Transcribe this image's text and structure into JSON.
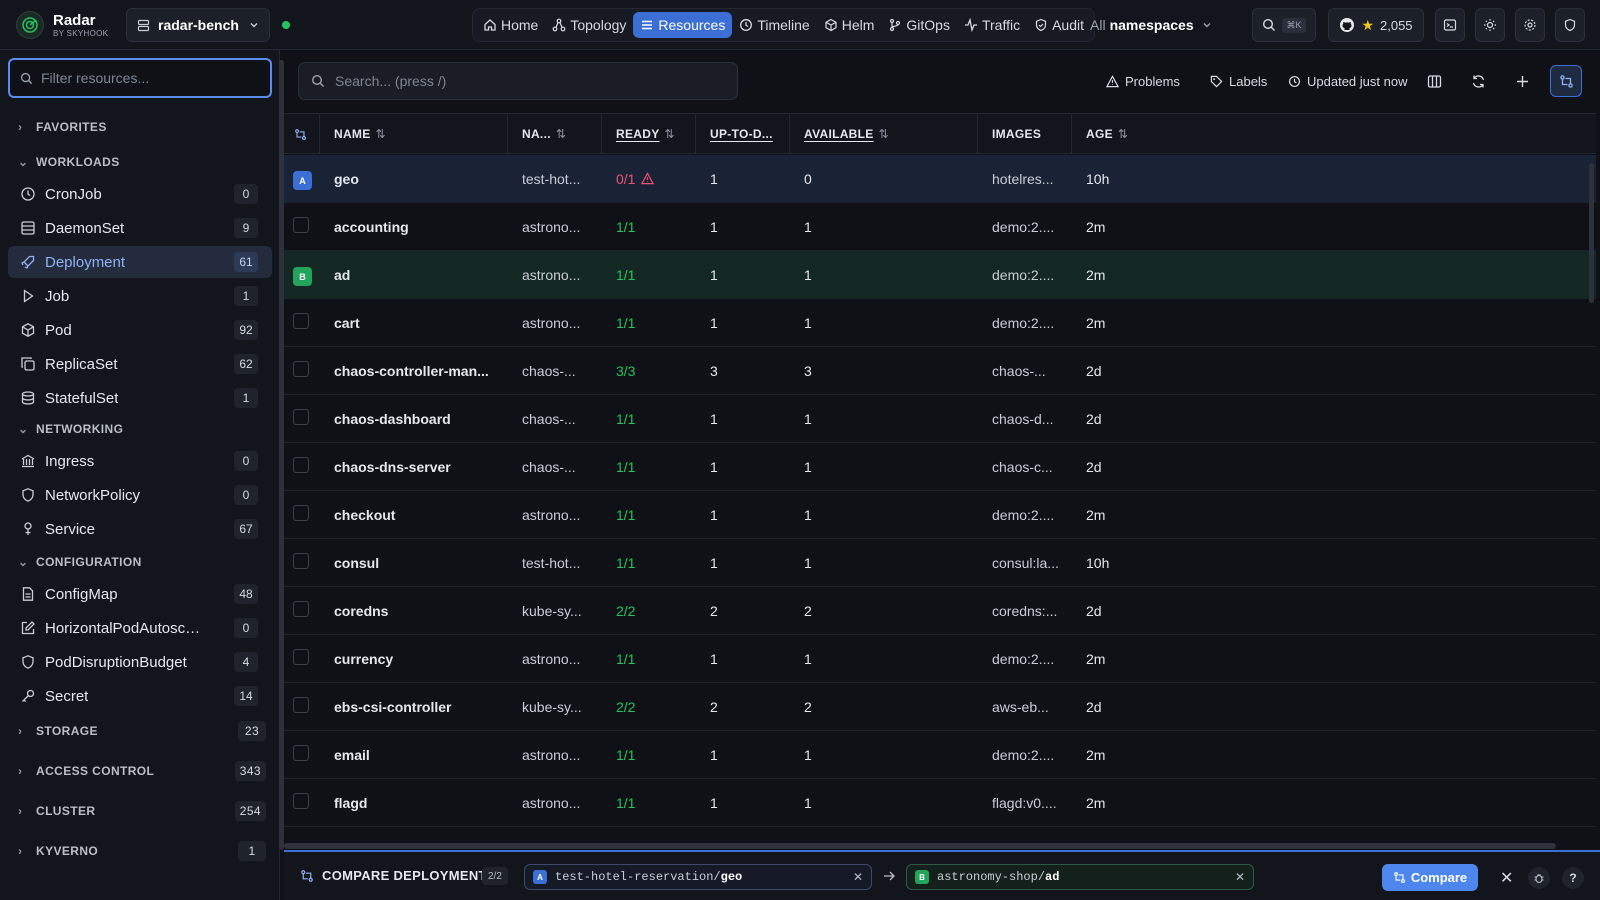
{
  "app": {
    "name": "Radar",
    "subtitle": "BY SKYHOOK"
  },
  "cluster": {
    "name": "radar-bench",
    "status_color": "#22c55e"
  },
  "nav": [
    {
      "label": "Home",
      "icon": "home-icon",
      "active": false
    },
    {
      "label": "Topology",
      "icon": "topology-icon",
      "active": false
    },
    {
      "label": "Resources",
      "icon": "list-icon",
      "active": true
    },
    {
      "label": "Timeline",
      "icon": "clock-icon",
      "active": false
    },
    {
      "label": "Helm",
      "icon": "package-icon",
      "active": false
    },
    {
      "label": "GitOps",
      "icon": "git-branch-icon",
      "active": false
    },
    {
      "label": "Traffic",
      "icon": "activity-icon",
      "active": false
    },
    {
      "label": "Audit",
      "icon": "shield-icon",
      "active": false
    }
  ],
  "namespace": {
    "prefix": "All",
    "label": "namespaces"
  },
  "search_shortcut": "⌘K",
  "github": {
    "stars": "2,055"
  },
  "sidebar": {
    "filter_placeholder": "Filter resources...",
    "sections": {
      "favorites": {
        "label": "FAVORITES"
      },
      "workloads": {
        "label": "WORKLOADS"
      },
      "networking": {
        "label": "NETWORKING"
      },
      "configuration": {
        "label": "CONFIGURATION"
      },
      "storage": {
        "label": "STORAGE",
        "count": "23"
      },
      "access_control": {
        "label": "ACCESS CONTROL",
        "count": "343"
      },
      "cluster": {
        "label": "CLUSTER",
        "count": "254"
      },
      "kyverno": {
        "label": "KYVERNO",
        "count": "1"
      }
    },
    "workloads": [
      {
        "label": "CronJob",
        "count": "0"
      },
      {
        "label": "DaemonSet",
        "count": "9"
      },
      {
        "label": "Deployment",
        "count": "61"
      },
      {
        "label": "Job",
        "count": "1"
      },
      {
        "label": "Pod",
        "count": "92"
      },
      {
        "label": "ReplicaSet",
        "count": "62"
      },
      {
        "label": "StatefulSet",
        "count": "1"
      }
    ],
    "networking": [
      {
        "label": "Ingress",
        "count": "0"
      },
      {
        "label": "NetworkPolicy",
        "count": "0"
      },
      {
        "label": "Service",
        "count": "67"
      }
    ],
    "configuration": [
      {
        "label": "ConfigMap",
        "count": "48"
      },
      {
        "label": "HorizontalPodAutoscal...",
        "count": "0"
      },
      {
        "label": "PodDisruptionBudget",
        "count": "4"
      },
      {
        "label": "Secret",
        "count": "14"
      }
    ]
  },
  "toolbar": {
    "search_placeholder": "Search... (press /)",
    "problems": "Problems",
    "labels": "Labels",
    "updated": "Updated just now"
  },
  "table": {
    "columns": {
      "name": "NAME",
      "namespace": "NA...",
      "ready": "READY",
      "uptodate": "UP-TO-D...",
      "available": "AVAILABLE",
      "images": "IMAGES",
      "age": "AGE"
    },
    "rows": [
      {
        "name": "geo",
        "namespace": "test-hot...",
        "ready": "0/1",
        "uptodate": "1",
        "available": "0",
        "images": "hotelres...",
        "age": "10h",
        "badge": "A",
        "warn": true
      },
      {
        "name": "accounting",
        "namespace": "astrono...",
        "ready": "1/1",
        "uptodate": "1",
        "available": "1",
        "images": "demo:2....",
        "age": "2m"
      },
      {
        "name": "ad",
        "namespace": "astrono...",
        "ready": "1/1",
        "uptodate": "1",
        "available": "1",
        "images": "demo:2....",
        "age": "2m",
        "badge": "B"
      },
      {
        "name": "cart",
        "namespace": "astrono...",
        "ready": "1/1",
        "uptodate": "1",
        "available": "1",
        "images": "demo:2....",
        "age": "2m"
      },
      {
        "name": "chaos-controller-man...",
        "namespace": "chaos-...",
        "ready": "3/3",
        "uptodate": "3",
        "available": "3",
        "images": "chaos-...",
        "age": "2d"
      },
      {
        "name": "chaos-dashboard",
        "namespace": "chaos-...",
        "ready": "1/1",
        "uptodate": "1",
        "available": "1",
        "images": "chaos-d...",
        "age": "2d"
      },
      {
        "name": "chaos-dns-server",
        "namespace": "chaos-...",
        "ready": "1/1",
        "uptodate": "1",
        "available": "1",
        "images": "chaos-c...",
        "age": "2d"
      },
      {
        "name": "checkout",
        "namespace": "astrono...",
        "ready": "1/1",
        "uptodate": "1",
        "available": "1",
        "images": "demo:2....",
        "age": "2m"
      },
      {
        "name": "consul",
        "namespace": "test-hot...",
        "ready": "1/1",
        "uptodate": "1",
        "available": "1",
        "images": "consul:la...",
        "age": "10h"
      },
      {
        "name": "coredns",
        "namespace": "kube-sy...",
        "ready": "2/2",
        "uptodate": "2",
        "available": "2",
        "images": "coredns:...",
        "age": "2d"
      },
      {
        "name": "currency",
        "namespace": "astrono...",
        "ready": "1/1",
        "uptodate": "1",
        "available": "1",
        "images": "demo:2....",
        "age": "2m"
      },
      {
        "name": "ebs-csi-controller",
        "namespace": "kube-sy...",
        "ready": "2/2",
        "uptodate": "2",
        "available": "2",
        "images": "aws-eb...",
        "age": "2d"
      },
      {
        "name": "email",
        "namespace": "astrono...",
        "ready": "1/1",
        "uptodate": "1",
        "available": "1",
        "images": "demo:2....",
        "age": "2m"
      },
      {
        "name": "flagd",
        "namespace": "astrono...",
        "ready": "1/1",
        "uptodate": "1",
        "available": "1",
        "images": "flagd:v0....",
        "age": "2m"
      }
    ]
  },
  "compare": {
    "title": "COMPARE DEPLOYMENT",
    "count": "2/2",
    "a": {
      "tag": "A",
      "ns": "test-hotel-reservation/",
      "name": "geo"
    },
    "b": {
      "tag": "B",
      "ns": "astronomy-shop/",
      "name": "ad"
    },
    "button": "Compare"
  },
  "colors": {
    "accent": "#3b6fd6",
    "ready_ok": "#22c55e",
    "ready_bad": "#f0506e"
  }
}
